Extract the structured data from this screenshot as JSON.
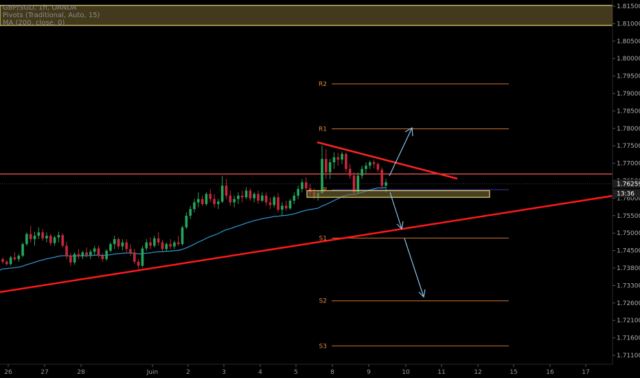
{
  "legend": {
    "symbol": "GBP/SGD, 1h, OANDA",
    "pivots": "Pivots (Traditional, Auto, 15)",
    "ma": "MA (200, close, 0)"
  },
  "chart_data": {
    "type": "candlestick",
    "x_ticks": [
      "26",
      "27",
      "28",
      "Juin",
      "2",
      "3",
      "4",
      "5",
      "8",
      "9",
      "10",
      "11",
      "12",
      "15",
      "16",
      "17"
    ],
    "y_ticks": [
      "1.81500",
      "1.81000",
      "1.80500",
      "1.80000",
      "1.79500",
      "1.79000",
      "1.78500",
      "1.78000",
      "1.77500",
      "1.77000",
      "1.76500",
      "1.76000",
      "1.75500",
      "1.75000",
      "1.74500",
      "1.73800",
      "1.73300",
      "1.72600",
      "1.72100",
      "1.71600",
      "1.71100"
    ],
    "ylim": [
      1.7085,
      1.8172
    ],
    "last_price": "1.76259",
    "countdown": "13:36",
    "pivots": [
      {
        "label": "R2",
        "value": 1.7925
      },
      {
        "label": "R1",
        "value": 1.779
      },
      {
        "label": "P",
        "value": 1.7608
      },
      {
        "label": "S1",
        "value": 1.7463
      },
      {
        "label": "S2",
        "value": 1.7275
      },
      {
        "label": "S3",
        "value": 1.714
      }
    ],
    "resistance_level": 1.7655,
    "supply_zone": [
      1.81,
      1.816
    ],
    "demand_zone": [
      1.7585,
      1.7605
    ],
    "candles": [
      [
        1.74,
        1.7405,
        1.7385,
        1.7392
      ],
      [
        1.7392,
        1.7398,
        1.738,
        1.7385
      ],
      [
        1.7385,
        1.741,
        1.738,
        1.7405
      ],
      [
        1.7405,
        1.742,
        1.7395,
        1.74
      ],
      [
        1.74,
        1.7415,
        1.7392,
        1.741
      ],
      [
        1.741,
        1.745,
        1.7405,
        1.7445
      ],
      [
        1.7445,
        1.748,
        1.744,
        1.7475
      ],
      [
        1.7475,
        1.75,
        1.745,
        1.746
      ],
      [
        1.746,
        1.7482,
        1.744,
        1.747
      ],
      [
        1.747,
        1.7495,
        1.746,
        1.748
      ],
      [
        1.748,
        1.749,
        1.7455,
        1.7462
      ],
      [
        1.7462,
        1.748,
        1.745,
        1.747
      ],
      [
        1.747,
        1.7475,
        1.744,
        1.7448
      ],
      [
        1.7448,
        1.747,
        1.744,
        1.7465
      ],
      [
        1.7465,
        1.7482,
        1.745,
        1.7472
      ],
      [
        1.7472,
        1.7478,
        1.7435,
        1.744
      ],
      [
        1.744,
        1.7452,
        1.74,
        1.741
      ],
      [
        1.741,
        1.7418,
        1.738,
        1.739
      ],
      [
        1.739,
        1.742,
        1.7383,
        1.7415
      ],
      [
        1.7415,
        1.743,
        1.74,
        1.7408
      ],
      [
        1.7408,
        1.7425,
        1.74,
        1.742
      ],
      [
        1.742,
        1.7435,
        1.7405,
        1.7412
      ],
      [
        1.7412,
        1.7428,
        1.74,
        1.7422
      ],
      [
        1.7422,
        1.744,
        1.741,
        1.7432
      ],
      [
        1.7432,
        1.744,
        1.7405,
        1.741
      ],
      [
        1.741,
        1.7418,
        1.7392,
        1.74
      ],
      [
        1.74,
        1.743,
        1.7395,
        1.7425
      ],
      [
        1.7425,
        1.745,
        1.742,
        1.7445
      ],
      [
        1.7445,
        1.747,
        1.743,
        1.746
      ],
      [
        1.746,
        1.7465,
        1.743,
        1.7438
      ],
      [
        1.7438,
        1.746,
        1.7425,
        1.745
      ],
      [
        1.745,
        1.746,
        1.742,
        1.743
      ],
      [
        1.743,
        1.7445,
        1.741,
        1.742
      ],
      [
        1.742,
        1.743,
        1.7385,
        1.7392
      ],
      [
        1.7392,
        1.74,
        1.737,
        1.738
      ],
      [
        1.738,
        1.744,
        1.7375,
        1.7432
      ],
      [
        1.7432,
        1.746,
        1.7425,
        1.745
      ],
      [
        1.745,
        1.7465,
        1.743,
        1.744
      ],
      [
        1.744,
        1.747,
        1.7435,
        1.7462
      ],
      [
        1.7462,
        1.748,
        1.744,
        1.745
      ],
      [
        1.745,
        1.7458,
        1.742,
        1.743
      ],
      [
        1.743,
        1.745,
        1.7425,
        1.7445
      ],
      [
        1.7445,
        1.746,
        1.743,
        1.7438
      ],
      [
        1.7438,
        1.7455,
        1.743,
        1.745
      ],
      [
        1.745,
        1.747,
        1.744,
        1.7445
      ],
      [
        1.7445,
        1.75,
        1.744,
        1.7495
      ],
      [
        1.7495,
        1.754,
        1.749,
        1.753
      ],
      [
        1.753,
        1.756,
        1.752,
        1.755
      ],
      [
        1.755,
        1.758,
        1.754,
        1.757
      ],
      [
        1.757,
        1.76,
        1.7555,
        1.758
      ],
      [
        1.758,
        1.759,
        1.756,
        1.7565
      ],
      [
        1.7565,
        1.76,
        1.756,
        1.7595
      ],
      [
        1.7595,
        1.761,
        1.757,
        1.758
      ],
      [
        1.758,
        1.7595,
        1.7555,
        1.7565
      ],
      [
        1.7565,
        1.758,
        1.755,
        1.7572
      ],
      [
        1.7572,
        1.765,
        1.7568,
        1.762
      ],
      [
        1.762,
        1.764,
        1.758,
        1.759
      ],
      [
        1.759,
        1.7605,
        1.756,
        1.757
      ],
      [
        1.757,
        1.759,
        1.7555,
        1.758
      ],
      [
        1.758,
        1.76,
        1.7565,
        1.759
      ],
      [
        1.759,
        1.7605,
        1.757,
        1.7585
      ],
      [
        1.7585,
        1.7615,
        1.758,
        1.7605
      ],
      [
        1.7605,
        1.7612,
        1.7575,
        1.7582
      ],
      [
        1.7582,
        1.76,
        1.757,
        1.7595
      ],
      [
        1.7595,
        1.7605,
        1.7565,
        1.7575
      ],
      [
        1.7575,
        1.76,
        1.757,
        1.759
      ],
      [
        1.759,
        1.76,
        1.756,
        1.757
      ],
      [
        1.757,
        1.7585,
        1.755,
        1.7562
      ],
      [
        1.7562,
        1.759,
        1.7555,
        1.7585
      ],
      [
        1.7585,
        1.7598,
        1.754,
        1.7548
      ],
      [
        1.7548,
        1.757,
        1.753,
        1.756
      ],
      [
        1.756,
        1.7575,
        1.7545,
        1.7552
      ],
      [
        1.7552,
        1.758,
        1.7548,
        1.7575
      ],
      [
        1.7575,
        1.76,
        1.7565,
        1.759
      ],
      [
        1.759,
        1.762,
        1.758,
        1.761
      ],
      [
        1.761,
        1.764,
        1.76,
        1.763
      ],
      [
        1.763,
        1.7645,
        1.7605,
        1.7612
      ],
      [
        1.7612,
        1.7625,
        1.759,
        1.76
      ],
      [
        1.76,
        1.7612,
        1.758,
        1.7588
      ],
      [
        1.7588,
        1.7605,
        1.7575,
        1.7598
      ],
      [
        1.7598,
        1.774,
        1.7595,
        1.77
      ],
      [
        1.77,
        1.773,
        1.764,
        1.766
      ],
      [
        1.766,
        1.77,
        1.764,
        1.769
      ],
      [
        1.769,
        1.772,
        1.767,
        1.7705
      ],
      [
        1.7705,
        1.7718,
        1.768,
        1.7698
      ],
      [
        1.7698,
        1.7722,
        1.7685,
        1.7715
      ],
      [
        1.7715,
        1.772,
        1.766,
        1.767
      ],
      [
        1.767,
        1.7685,
        1.764,
        1.765
      ],
      [
        1.765,
        1.766,
        1.759,
        1.76
      ],
      [
        1.76,
        1.766,
        1.7595,
        1.765
      ],
      [
        1.765,
        1.768,
        1.764,
        1.767
      ],
      [
        1.767,
        1.769,
        1.7655,
        1.768
      ],
      [
        1.768,
        1.7695,
        1.767,
        1.769
      ],
      [
        1.769,
        1.7698,
        1.7672,
        1.7685
      ],
      [
        1.7685,
        1.769,
        1.766,
        1.7668
      ],
      [
        1.7668,
        1.7675,
        1.761,
        1.762
      ],
      [
        1.762,
        1.764,
        1.76,
        1.763
      ]
    ]
  }
}
